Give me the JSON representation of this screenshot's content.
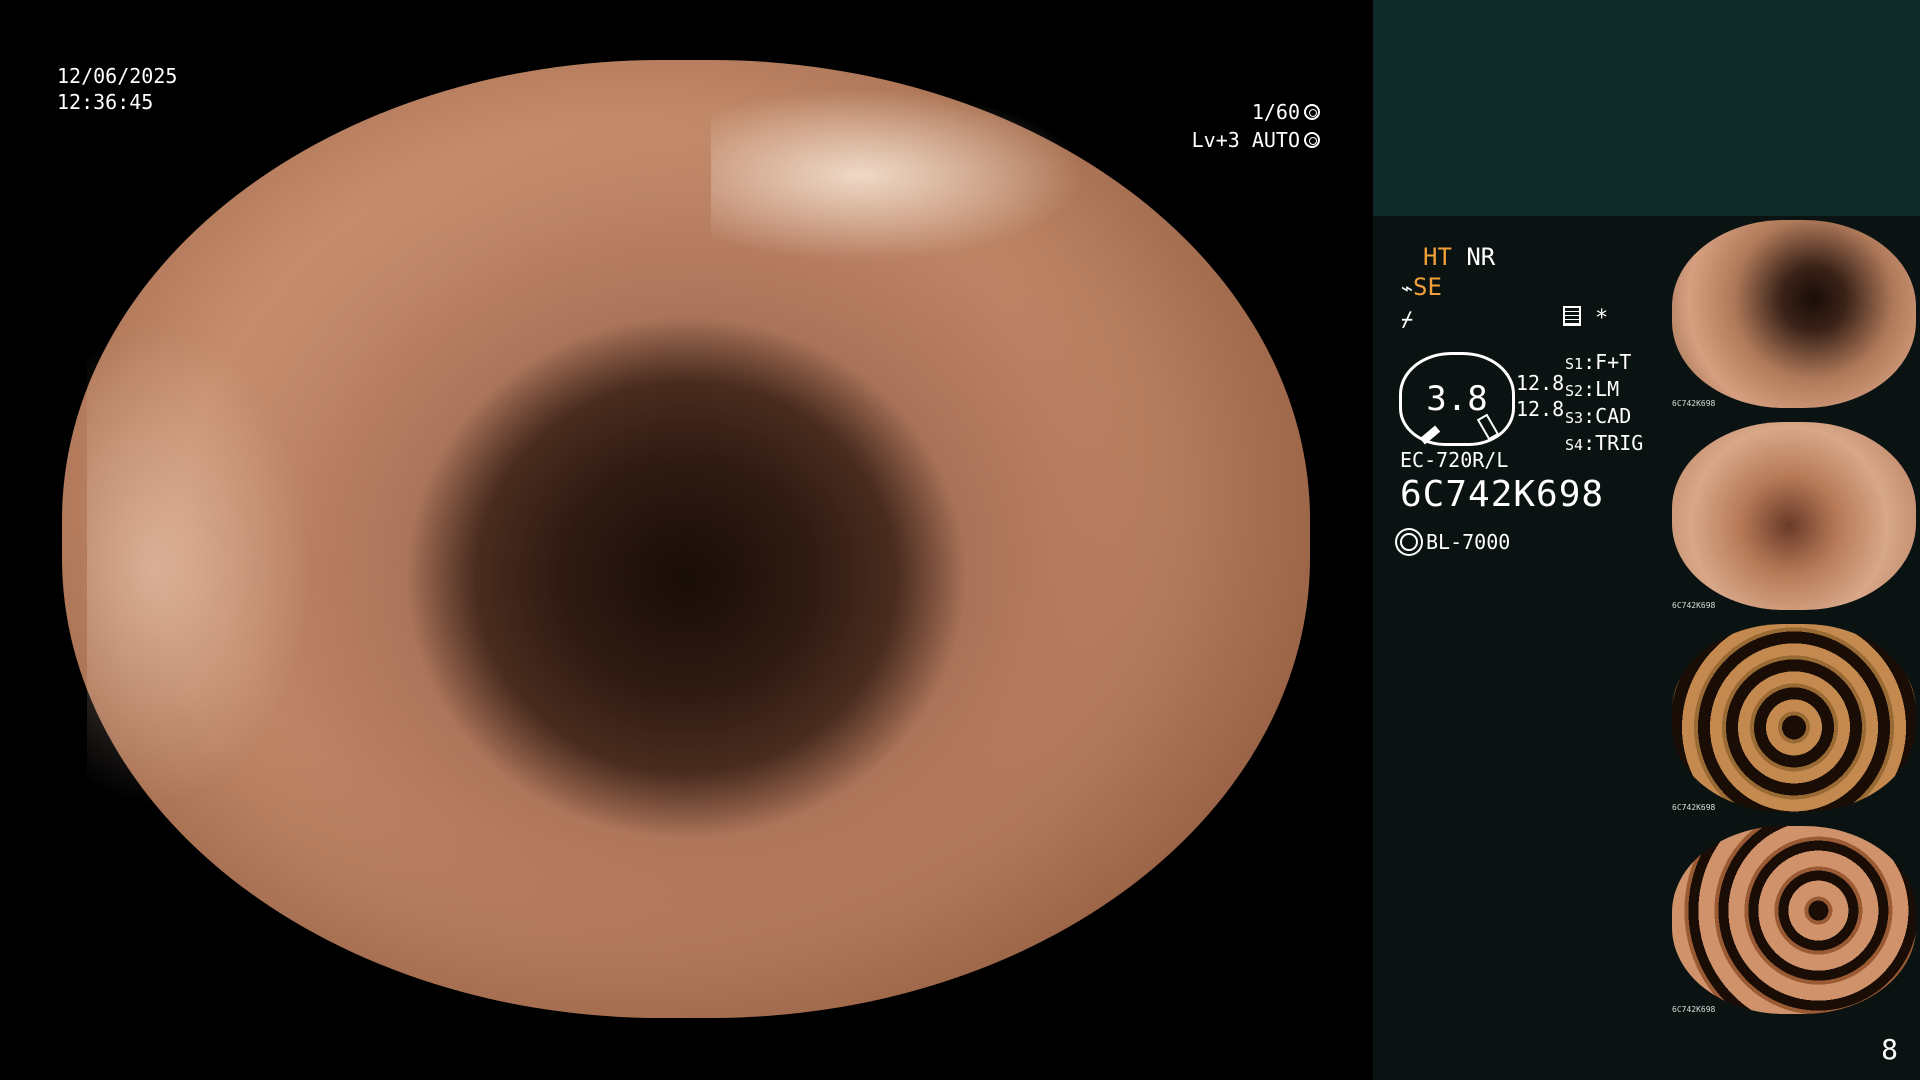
{
  "overlay": {
    "date": "12/06/2025",
    "time": "12:36:45",
    "shutter": "1/60",
    "level": "Lv+3 AUTO"
  },
  "panel": {
    "mode_ht": "HT",
    "mode_nr": "NR",
    "mode_se": "SE",
    "star": "*",
    "gauge_value": "3.8",
    "gauge_side_1": "12.8",
    "gauge_side_2": "12.8",
    "switches": [
      {
        "key": "S1",
        "value": "F+T"
      },
      {
        "key": "S2",
        "value": "LM"
      },
      {
        "key": "S3",
        "value": "CAD"
      },
      {
        "key": "S4",
        "value": "TRIG"
      }
    ],
    "scope_model": "EC-720R/L",
    "serial": "6C742K698",
    "light_source": "BL-7000",
    "page_number": "8"
  },
  "thumbnails": [
    {
      "label": "6C742K698"
    },
    {
      "label": "6C742K698"
    },
    {
      "label": "6C742K698"
    },
    {
      "label": "6C742K698"
    }
  ],
  "colors": {
    "panel_bg": "#0a1212",
    "panel_top": "#102a2a",
    "accent": "#f2a03a"
  }
}
